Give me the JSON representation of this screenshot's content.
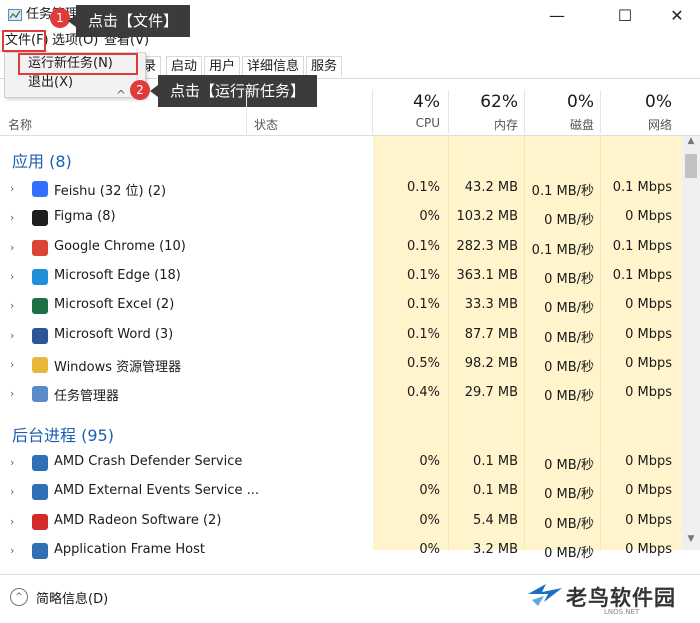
{
  "window": {
    "title": "任务管理器",
    "minimize": "—",
    "maximize": "☐",
    "close": "✕"
  },
  "menubar": {
    "file": "文件(F)",
    "options": "选项(O)",
    "view": "查看(V)"
  },
  "file_menu": {
    "run_new_task": "运行新任务(N)",
    "exit": "退出(X)"
  },
  "tabs": [
    "录",
    "启动",
    "用户",
    "详细信息",
    "服务"
  ],
  "annotations": {
    "step1_num": "1",
    "step1_text": "点击【文件】",
    "step2_num": "2",
    "step2_text": "点击【运行新任务】"
  },
  "headers": {
    "sort_arrow": "^",
    "name": "名称",
    "status": "状态",
    "cpu_pct": "4%",
    "cpu": "CPU",
    "mem_pct": "62%",
    "mem": "内存",
    "disk_pct": "0%",
    "disk": "磁盘",
    "net_pct": "0%",
    "net": "网络"
  },
  "groups": {
    "apps": "应用 (8)",
    "background": "后台进程 (95)"
  },
  "apps": [
    {
      "name": "Feishu (32 位) (2)",
      "cpu": "0.1%",
      "mem": "43.2 MB",
      "disk": "0.1 MB/秒",
      "net": "0.1 Mbps",
      "icon": "feishu-icon",
      "color": "#3370ff"
    },
    {
      "name": "Figma (8)",
      "cpu": "0%",
      "mem": "103.2 MB",
      "disk": "0 MB/秒",
      "net": "0 Mbps",
      "icon": "figma-icon",
      "color": "#1e1e1e"
    },
    {
      "name": "Google Chrome (10)",
      "cpu": "0.1%",
      "mem": "282.3 MB",
      "disk": "0.1 MB/秒",
      "net": "0.1 Mbps",
      "icon": "chrome-icon",
      "color": "#db4437"
    },
    {
      "name": "Microsoft Edge (18)",
      "cpu": "0.1%",
      "mem": "363.1 MB",
      "disk": "0 MB/秒",
      "net": "0.1 Mbps",
      "icon": "edge-icon",
      "color": "#1f8fd8"
    },
    {
      "name": "Microsoft Excel (2)",
      "cpu": "0.1%",
      "mem": "33.3 MB",
      "disk": "0 MB/秒",
      "net": "0 Mbps",
      "icon": "excel-icon",
      "color": "#1d7044"
    },
    {
      "name": "Microsoft Word (3)",
      "cpu": "0.1%",
      "mem": "87.7 MB",
      "disk": "0 MB/秒",
      "net": "0 Mbps",
      "icon": "word-icon",
      "color": "#2b5797"
    },
    {
      "name": "Windows 资源管理器",
      "cpu": "0.5%",
      "mem": "98.2 MB",
      "disk": "0 MB/秒",
      "net": "0 Mbps",
      "icon": "folder-icon",
      "color": "#e8b73d"
    },
    {
      "name": "任务管理器",
      "cpu": "0.4%",
      "mem": "29.7 MB",
      "disk": "0 MB/秒",
      "net": "0 Mbps",
      "icon": "task-manager-icon",
      "color": "#5b8bc9"
    }
  ],
  "background": [
    {
      "name": "AMD Crash Defender Service",
      "cpu": "0%",
      "mem": "0.1 MB",
      "disk": "0 MB/秒",
      "net": "0 Mbps",
      "icon": "service-icon",
      "color": "#2f6fb3"
    },
    {
      "name": "AMD External Events Service ...",
      "cpu": "0%",
      "mem": "0.1 MB",
      "disk": "0 MB/秒",
      "net": "0 Mbps",
      "icon": "service-icon",
      "color": "#2f6fb3"
    },
    {
      "name": "AMD Radeon Software (2)",
      "cpu": "0%",
      "mem": "5.4 MB",
      "disk": "0 MB/秒",
      "net": "0 Mbps",
      "icon": "amd-icon",
      "color": "#d42a2a"
    },
    {
      "name": "Application Frame Host",
      "cpu": "0%",
      "mem": "3.2 MB",
      "disk": "0 MB/秒",
      "net": "0 Mbps",
      "icon": "service-icon",
      "color": "#2f6fb3"
    }
  ],
  "footer": {
    "fewer_details": "简略信息(D)",
    "collapse_glyph": "^"
  },
  "watermark": {
    "text": "老鸟软件园",
    "url": "LNOS.NET"
  },
  "colors": {
    "accent_red": "#e03a3a",
    "highlight_yellow": "#fff4cc",
    "group_blue": "#1a5fb4"
  }
}
